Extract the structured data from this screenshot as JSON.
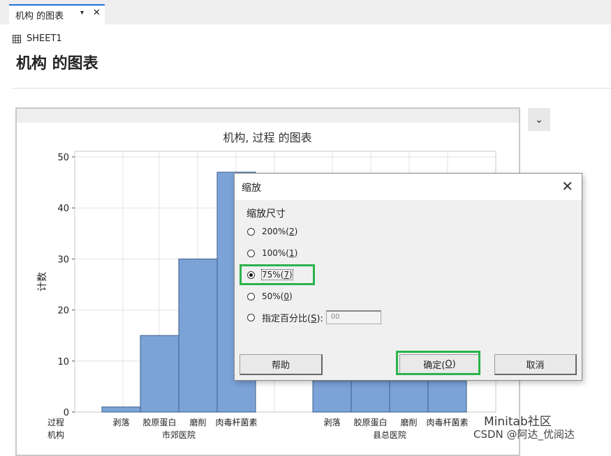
{
  "tab": {
    "label": "机构 的图表"
  },
  "sheet": {
    "name": "SHEET1"
  },
  "page": {
    "title": "机构 的图表"
  },
  "chart_data": {
    "type": "bar",
    "title": "机构, 过程 的图表",
    "ylabel": "计数",
    "ylim": [
      0,
      50
    ],
    "yticks": [
      0,
      10,
      20,
      30,
      40,
      50
    ],
    "groups": [
      {
        "name": "市郊医院",
        "categories": [
          "剥落",
          "胶原蛋白",
          "磨削",
          "肉毒杆菌素"
        ],
        "values": [
          1,
          15,
          30,
          47
        ]
      },
      {
        "name": "县总医院",
        "categories": [
          "剥落",
          "胶原蛋白",
          "磨削",
          "肉毒杆菌素"
        ],
        "values": [
          null,
          null,
          null,
          null
        ]
      }
    ],
    "x_row_labels": [
      "过程",
      "机构"
    ],
    "bar_color": "#7ba3d8",
    "grid": true
  },
  "dialog": {
    "title": "缩放",
    "group_label": "缩放尺寸",
    "options": [
      {
        "label": "200%(",
        "key": "2",
        "suffix": ")",
        "selected": false
      },
      {
        "label": "100%(",
        "key": "1",
        "suffix": ")",
        "selected": false
      },
      {
        "label": "75%(",
        "key": "7",
        "suffix": ")",
        "selected": true
      },
      {
        "label": "50%(",
        "key": "0",
        "suffix": ")",
        "selected": false
      },
      {
        "label": "指定百分比(",
        "key": "S",
        "suffix": "):",
        "selected": false
      }
    ],
    "custom_placeholder": "00",
    "help_label": "帮助",
    "ok_label_prefix": "确定(",
    "ok_key": "O",
    "ok_label_suffix": ")",
    "cancel_label": "取消"
  },
  "watermark": {
    "line1": "Minitab社区",
    "line2": "CSDN @阿达_优阅达"
  },
  "accent": "#1e6fd9",
  "highlight": "#2bb24c"
}
